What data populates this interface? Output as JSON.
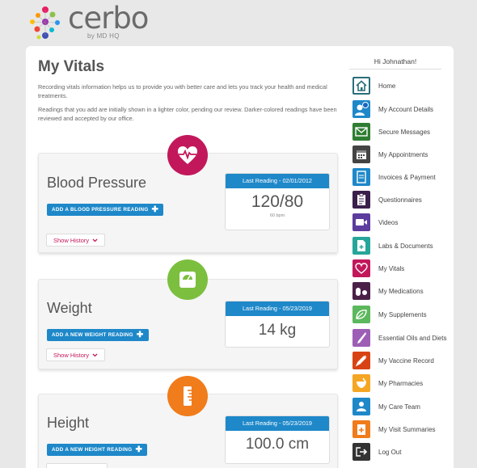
{
  "brand": {
    "name": "cerbo",
    "tagline": "by MD HQ"
  },
  "page": {
    "title": "My Vitals",
    "intro": [
      "Recording vitals information helps us to provide you with better care and lets you track your health and medical treatments.",
      "Readings that you add are initially shown in a lighter color, pending our review. Darker-colored readings have been reviewed and accepted by our office."
    ]
  },
  "vitals": [
    {
      "name": "Blood Pressure",
      "add_label": "ADD A BLOOD PRESSURE READING",
      "history_label": "Show History",
      "reading_header": "Last Reading - 02/01/2012",
      "value": "120/80",
      "sub": "60 bpm",
      "badge_color": "#c2185b",
      "badge_icon": "heart-pulse-icon"
    },
    {
      "name": "Weight",
      "add_label": "ADD A NEW WEIGHT READING",
      "history_label": "Show History",
      "reading_header": "Last Reading - 05/23/2019",
      "value": "14 kg",
      "sub": "",
      "badge_color": "#7cbf3f",
      "badge_icon": "scale-icon"
    },
    {
      "name": "Height",
      "add_label": "ADD A NEW HEIGHT READING",
      "history_label": "",
      "reading_header": "Last Reading - 05/23/2019",
      "value": "100.0 cm",
      "sub": "",
      "badge_color": "#f07c1b",
      "badge_icon": "ruler-icon"
    }
  ],
  "sidebar": {
    "greeting": "Hi Johnathan!",
    "items": [
      {
        "label": "Home",
        "color": "#2a6e7a",
        "icon": "home-icon"
      },
      {
        "label": "My Account Details",
        "color": "#1e88c9",
        "icon": "account-icon"
      },
      {
        "label": "Secure Messages",
        "color": "#2e7d32",
        "icon": "messages-icon"
      },
      {
        "label": "My Appointments",
        "color": "#444444",
        "icon": "calendar-icon"
      },
      {
        "label": "Invoices & Payment",
        "color": "#1e88c9",
        "icon": "invoice-icon"
      },
      {
        "label": "Questionnaires",
        "color": "#3a1f4a",
        "icon": "clipboard-icon"
      },
      {
        "label": "Videos",
        "color": "#5c3d9e",
        "icon": "video-icon"
      },
      {
        "label": "Labs & Documents",
        "color": "#26a69a",
        "icon": "document-icon"
      },
      {
        "label": "My Vitals",
        "color": "#c2185b",
        "icon": "heart-pulse-icon"
      },
      {
        "label": "My Medications",
        "color": "#4a2048",
        "icon": "pills-icon"
      },
      {
        "label": "My Supplements",
        "color": "#5cb85c",
        "icon": "leaf-icon"
      },
      {
        "label": "Essential Oils and Diets",
        "color": "#9c5fb5",
        "icon": "dropper-icon"
      },
      {
        "label": "My Vaccine Record",
        "color": "#d84315",
        "icon": "syringe-icon"
      },
      {
        "label": "My Pharmacies",
        "color": "#f5a623",
        "icon": "mortar-icon"
      },
      {
        "label": "My Care Team",
        "color": "#1e88c9",
        "icon": "team-icon"
      },
      {
        "label": "My Visit Summaries",
        "color": "#f07c1b",
        "icon": "summary-icon"
      },
      {
        "label": "Log Out",
        "color": "#333333",
        "icon": "logout-icon"
      }
    ]
  }
}
